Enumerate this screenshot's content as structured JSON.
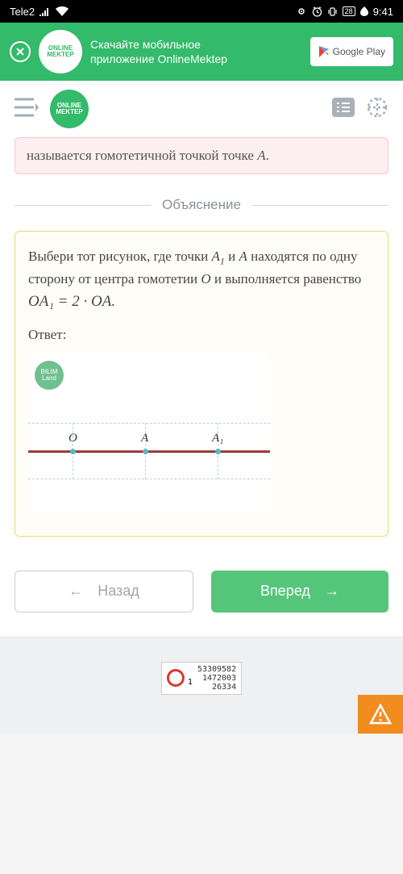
{
  "status": {
    "carrier": "Tele2",
    "battery": "28",
    "time": "9:41"
  },
  "banner": {
    "logo_text": "ONLINE MEKTEP",
    "line1": "Скачайте мобильное",
    "line2": "приложение OnlineMektep",
    "store_label": "Google Play"
  },
  "header": {
    "logo_text": "ONLINE MEKTEP"
  },
  "note": {
    "text_prefix": "называется гомотетичной точкой точке ",
    "math": "A",
    "text_suffix": "."
  },
  "section": {
    "title": "Объяснение"
  },
  "explanation": {
    "p1": "Выбери тот рисунок, где точки ",
    "m1": "A",
    "m1sub": "1",
    "p2": " и ",
    "m2": "A",
    "p3": " находятся по одну сторону от центра гомотетии ",
    "m3": "O",
    "p4": " и выполняется равенство ",
    "eq": "OA₁ = 2 · OA.",
    "answer_label": "Ответ:"
  },
  "figure": {
    "logo": "BILIM Land",
    "O": "O",
    "A": "A",
    "A1": "A₁"
  },
  "nav": {
    "back": "Назад",
    "next": "Вперед"
  },
  "counter": {
    "n1": "53309582",
    "n2": "1472003",
    "n3_left": "1",
    "n3": "26334"
  }
}
